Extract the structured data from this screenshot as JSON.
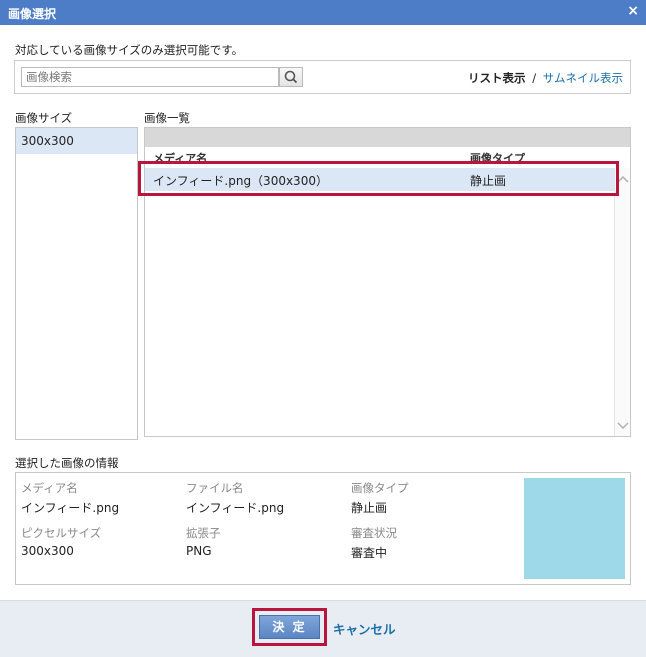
{
  "dialog": {
    "title": "画像選択",
    "close_label": "×"
  },
  "instruction": "対応している画像サイズのみ選択可能です。",
  "search": {
    "placeholder": "画像検索",
    "value": ""
  },
  "view_toggle": {
    "list_label": "リスト表示",
    "separator": "/",
    "thumbnail_label": "サムネイル表示"
  },
  "size_panel": {
    "heading": "画像サイズ",
    "items": [
      {
        "label": "300x300"
      }
    ]
  },
  "image_list": {
    "heading": "画像一覧",
    "columns": {
      "name": "メディア名",
      "type": "画像タイプ"
    },
    "rows": [
      {
        "name": "インフィード.png（300x300）",
        "type": "静止画"
      }
    ]
  },
  "selected_info": {
    "heading": "選択した画像の情報",
    "media_name_label": "メディア名",
    "media_name_value": "インフィード.png",
    "file_name_label": "ファイル名",
    "file_name_value": "インフィード.png",
    "image_type_label": "画像タイプ",
    "image_type_value": "静止画",
    "pixel_size_label": "ピクセルサイズ",
    "pixel_size_value": "300x300",
    "extension_label": "拡張子",
    "extension_value": "PNG",
    "review_status_label": "審査状況",
    "review_status_value": "審査中",
    "thumbnail_color": "#9dd9e8"
  },
  "footer": {
    "ok_label": "決 定",
    "cancel_label": "キャンセル"
  },
  "colors": {
    "titlebar": "#4d7dc7",
    "highlight": "#b8163d",
    "link": "#1d6fa8",
    "selected_row": "#dce7f5"
  },
  "icons": {
    "search": "search-icon",
    "close": "close-icon",
    "scroll_up": "chevron-up-icon",
    "scroll_down": "chevron-down-icon"
  }
}
